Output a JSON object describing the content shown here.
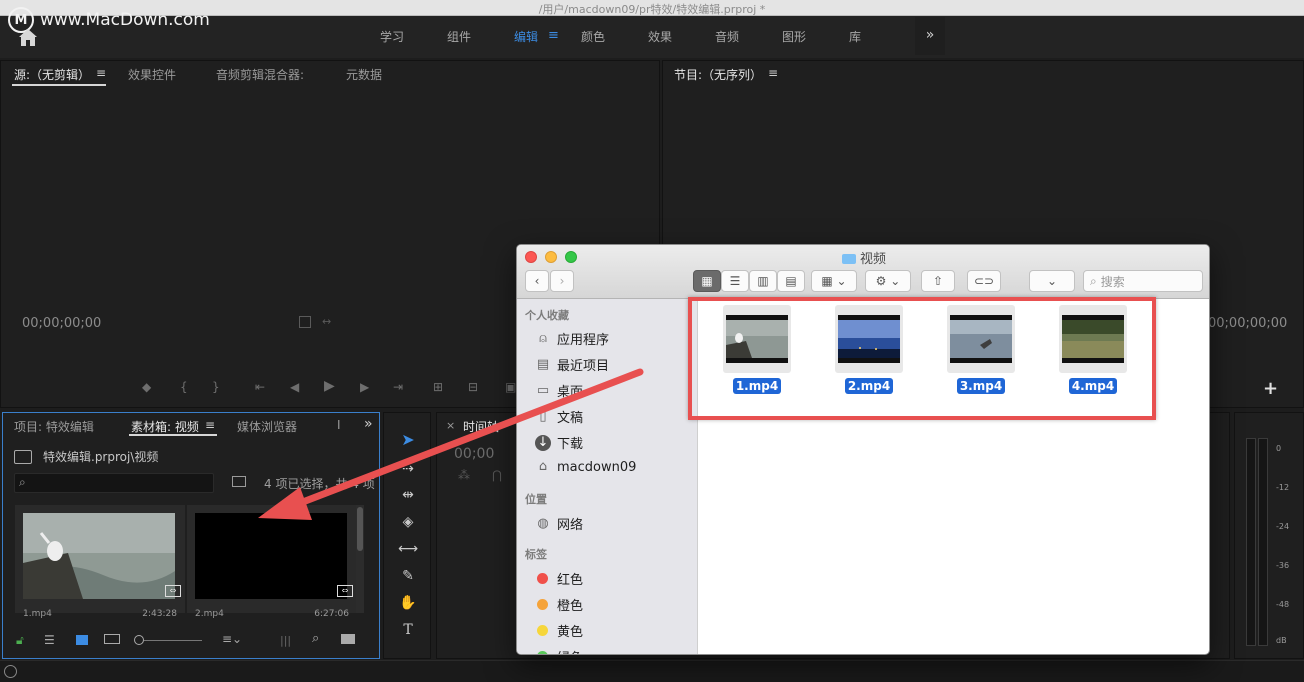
{
  "window": {
    "title": "/用户/macdown09/pr特效/特效编辑.prproj *"
  },
  "watermark": {
    "logo": "M",
    "text": "www.MacDown.com"
  },
  "workspaces": {
    "tabs": [
      {
        "label": "学习"
      },
      {
        "label": "组件"
      },
      {
        "label": "编辑"
      },
      {
        "label": "颜色"
      },
      {
        "label": "效果"
      },
      {
        "label": "音频"
      },
      {
        "label": "图形"
      },
      {
        "label": "库"
      }
    ],
    "active": "编辑",
    "menu_glyph": "≡",
    "more_glyph": "»"
  },
  "source_panel": {
    "tabs": [
      {
        "label": "源:（无剪辑）"
      },
      {
        "label": "≡"
      },
      {
        "label": "效果控件"
      },
      {
        "label": "音频剪辑混合器:"
      },
      {
        "label": "元数据"
      }
    ],
    "timecode": "00;00;00;00"
  },
  "program_panel": {
    "title": "节目:（无序列）",
    "menu": "≡",
    "timecode": "00;00;00;00",
    "add_glyph": "+"
  },
  "project_panel": {
    "tabs": [
      {
        "label": "项目: 特效编辑"
      },
      {
        "label": "素材箱: 视频"
      },
      {
        "label": "≡"
      },
      {
        "label": "媒体浏览器"
      },
      {
        "label": "I"
      },
      {
        "label": "»"
      }
    ],
    "path": "特效编辑.prproj\\视频",
    "selection": "4 项已选择，共 4 项",
    "items": [
      {
        "name": "1.mp4",
        "duration": "2:43:28"
      },
      {
        "name": "2.mp4",
        "duration": "6:27:06"
      }
    ]
  },
  "timeline_panel": {
    "tab": "时间轴",
    "timecode": "00;00"
  },
  "meters": {
    "labels": [
      "0",
      "-12",
      "-24",
      "-36",
      "-48",
      "dB"
    ]
  },
  "finder": {
    "title": "视频",
    "search_placeholder": "搜索",
    "favorites_heading": "个人收藏",
    "favorites": [
      {
        "label": "应用程序",
        "icon": "applications-icon"
      },
      {
        "label": "最近项目",
        "icon": "recents-icon"
      },
      {
        "label": "桌面",
        "icon": "desktop-icon"
      },
      {
        "label": "文稿",
        "icon": "documents-icon"
      },
      {
        "label": "下载",
        "icon": "downloads-icon"
      },
      {
        "label": "macdown09",
        "icon": "home-icon"
      }
    ],
    "locations_heading": "位置",
    "locations": [
      {
        "label": "网络",
        "icon": "network-icon"
      }
    ],
    "tags_heading": "标签",
    "tags": [
      {
        "label": "红色",
        "color": "#f0504a"
      },
      {
        "label": "橙色",
        "color": "#f5a33a"
      },
      {
        "label": "黄色",
        "color": "#f6d63b"
      },
      {
        "label": "绿色",
        "color": "#5ac85a"
      }
    ],
    "files": [
      {
        "name": "1.mp4"
      },
      {
        "name": "2.mp4"
      },
      {
        "name": "3.mp4"
      },
      {
        "name": "4.mp4"
      }
    ]
  },
  "colors": {
    "accent": "#3c8ce3",
    "selection": "#1f66d6",
    "annotation": "#e85050"
  }
}
